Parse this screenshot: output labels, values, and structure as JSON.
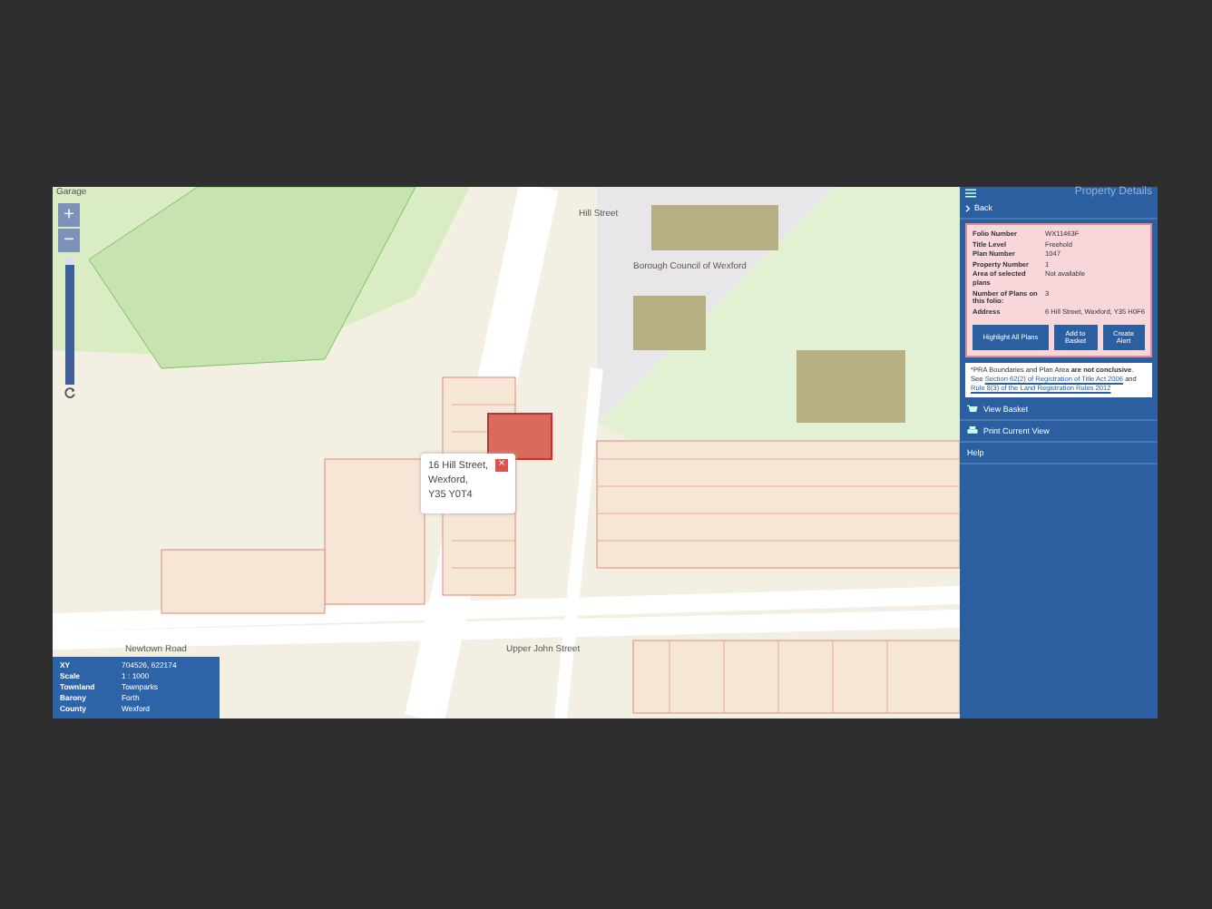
{
  "map": {
    "corner_label": "Garage",
    "labels": [
      {
        "text": "Hill Street",
        "kind": "road"
      },
      {
        "text": "Borough Council of Wexford",
        "kind": "building"
      },
      {
        "text": "Newtown Road",
        "kind": "road"
      },
      {
        "text": "Upper John Street",
        "kind": "road"
      }
    ],
    "zoom": {
      "in": "+",
      "out": "−",
      "slider": {
        "level": 0.95
      }
    },
    "popup": {
      "lines": [
        "16 Hill Street,",
        "Wexford,",
        "Y35 Y0T4"
      ],
      "close": "×"
    },
    "info": [
      {
        "label": "XY",
        "value": "704526, 622174"
      },
      {
        "label": "Scale",
        "value": "1 : 1000"
      },
      {
        "label": "Townland",
        "value": "Townparks"
      },
      {
        "label": "Barony",
        "value": "Forth"
      },
      {
        "label": "County",
        "value": "Wexford"
      }
    ]
  },
  "panel": {
    "title": "Property Details",
    "back": "Back",
    "details": [
      {
        "label": "Folio Number",
        "value": "WX11463F"
      },
      {
        "label": "Title Level",
        "value": "Freehold"
      },
      {
        "label": "Plan Number",
        "value": "1047"
      },
      {
        "label": "Property Number",
        "value": "1"
      },
      {
        "label": "Area of selected plans",
        "value": "Not available"
      },
      {
        "label": "Number of Plans on this folio:",
        "value": "3"
      },
      {
        "label": "Address",
        "value": "6 Hill Street, Wexford, Y35 H0F6"
      }
    ],
    "buttons": [
      "Highlight All Plans",
      "Add to Basket",
      "Create Alert"
    ],
    "note": "*PRA Boundaries and Plan Area **are not conclusive**. See ",
    "links": [
      "Section 62(2) of Registration of Title Act 2006",
      "Rule 8(3) of the Land Registration Rules 2012"
    ],
    "note_join": " and ",
    "menu": [
      {
        "label": "View Basket",
        "kind": "basket"
      },
      {
        "label": "Print Current View",
        "kind": "print"
      },
      {
        "label": "Help",
        "kind": "none"
      }
    ]
  }
}
